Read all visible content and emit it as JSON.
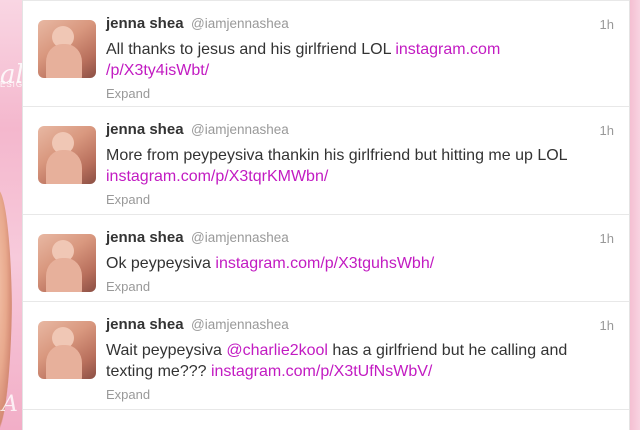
{
  "timeline": {
    "tweets": [
      {
        "name": "jenna shea",
        "handle": "@iamjennashea",
        "time": "1h",
        "text_parts": [
          "All thanks to jesus and his girlfriend LOL ",
          ""
        ],
        "link_1": "instagram.com",
        "link_2": "/p/X3ty4isWbt/",
        "expand": "Expand"
      },
      {
        "name": "jenna shea",
        "handle": "@iamjennashea",
        "time": "1h",
        "text": "More from peypeysiva thankin his girlfriend but hitting me up LOL",
        "link": "instagram.com/p/X3tqrKMWbn/",
        "expand": "Expand"
      },
      {
        "name": "jenna shea",
        "handle": "@iamjennashea",
        "time": "1h",
        "text": "Ok peypeysiva ",
        "link": "instagram.com/p/X3tguhsWbh/",
        "expand": "Expand"
      },
      {
        "name": "jenna shea",
        "handle": "@iamjennashea",
        "time": "1h",
        "text_1": "Wait peypeysiva ",
        "mention": "@charlie2kool",
        "text_2": " has a girlfriend but he calling and texting me??? ",
        "link": "instagram.com/p/X3tUfNsWbV/",
        "expand": "Expand"
      }
    ]
  },
  "colors": {
    "link": "#c21bc2",
    "background_pink": "#f7c9da"
  }
}
